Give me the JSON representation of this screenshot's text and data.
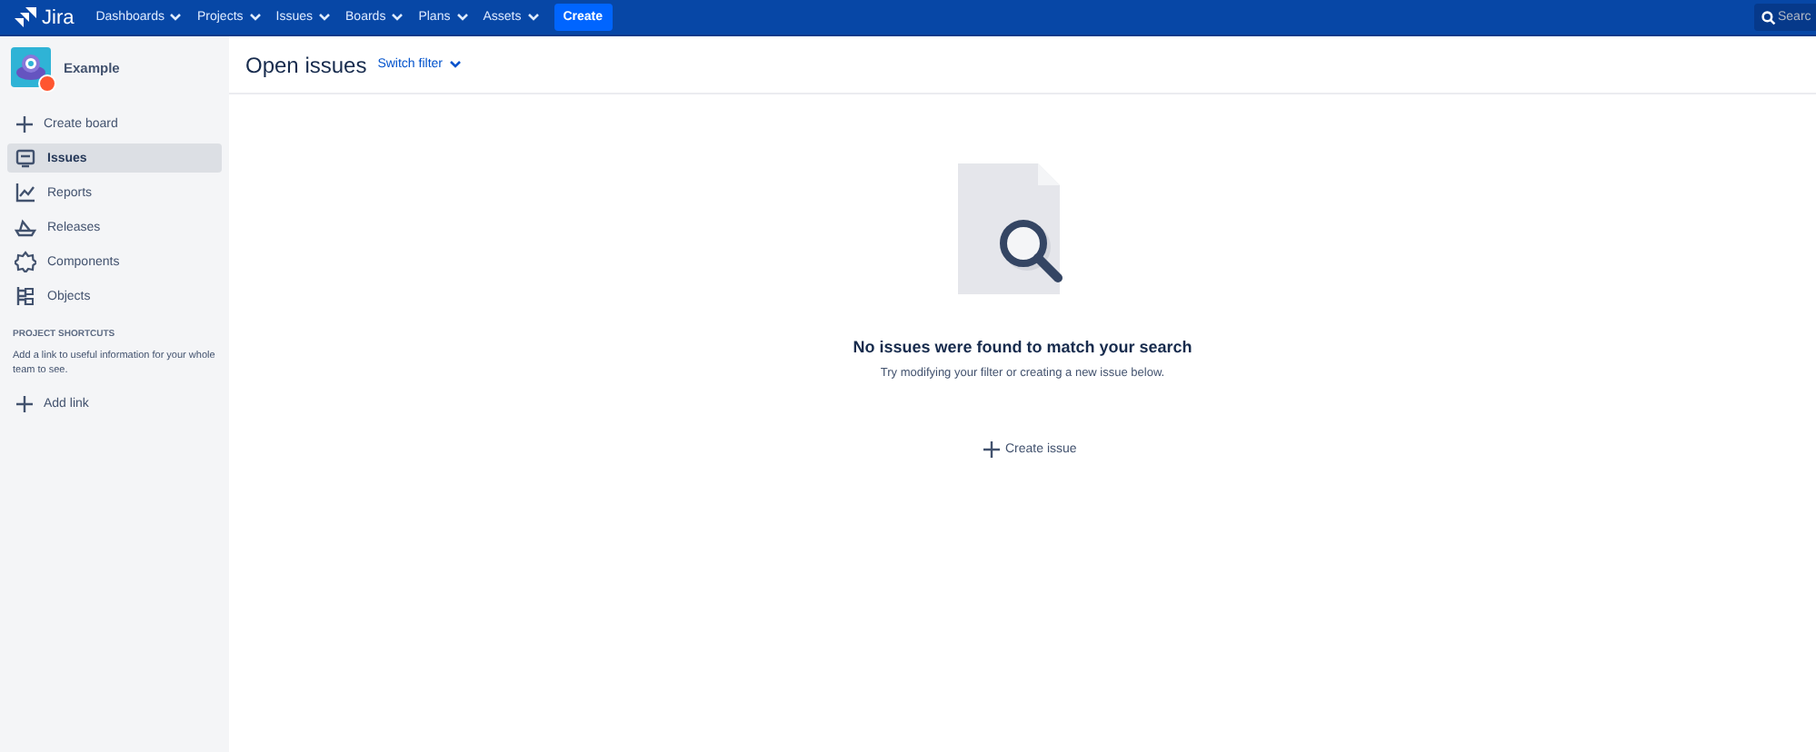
{
  "topbar": {
    "product": "Jira",
    "menus": [
      {
        "label": "Dashboards"
      },
      {
        "label": "Projects"
      },
      {
        "label": "Issues"
      },
      {
        "label": "Boards"
      },
      {
        "label": "Plans"
      },
      {
        "label": "Assets"
      }
    ],
    "create": "Create",
    "search": {
      "placeholder": "Searc"
    }
  },
  "sidebar": {
    "project": "Example",
    "create_board": "Create board",
    "items": [
      {
        "label": "Issues",
        "selected": true
      },
      {
        "label": "Reports",
        "selected": false
      },
      {
        "label": "Releases",
        "selected": false
      },
      {
        "label": "Components",
        "selected": false
      },
      {
        "label": "Objects",
        "selected": false
      }
    ],
    "shortcuts_heading": "PROJECT SHORTCUTS",
    "shortcuts_text": "Add a link to useful information for your whole team to see.",
    "add_link": "Add link"
  },
  "main": {
    "title": "Open issues",
    "switch_filter": "Switch filter",
    "empty_heading": "No issues were found to match your search",
    "empty_text": "Try modifying your filter or creating a new issue below.",
    "create_issue": "Create issue"
  }
}
